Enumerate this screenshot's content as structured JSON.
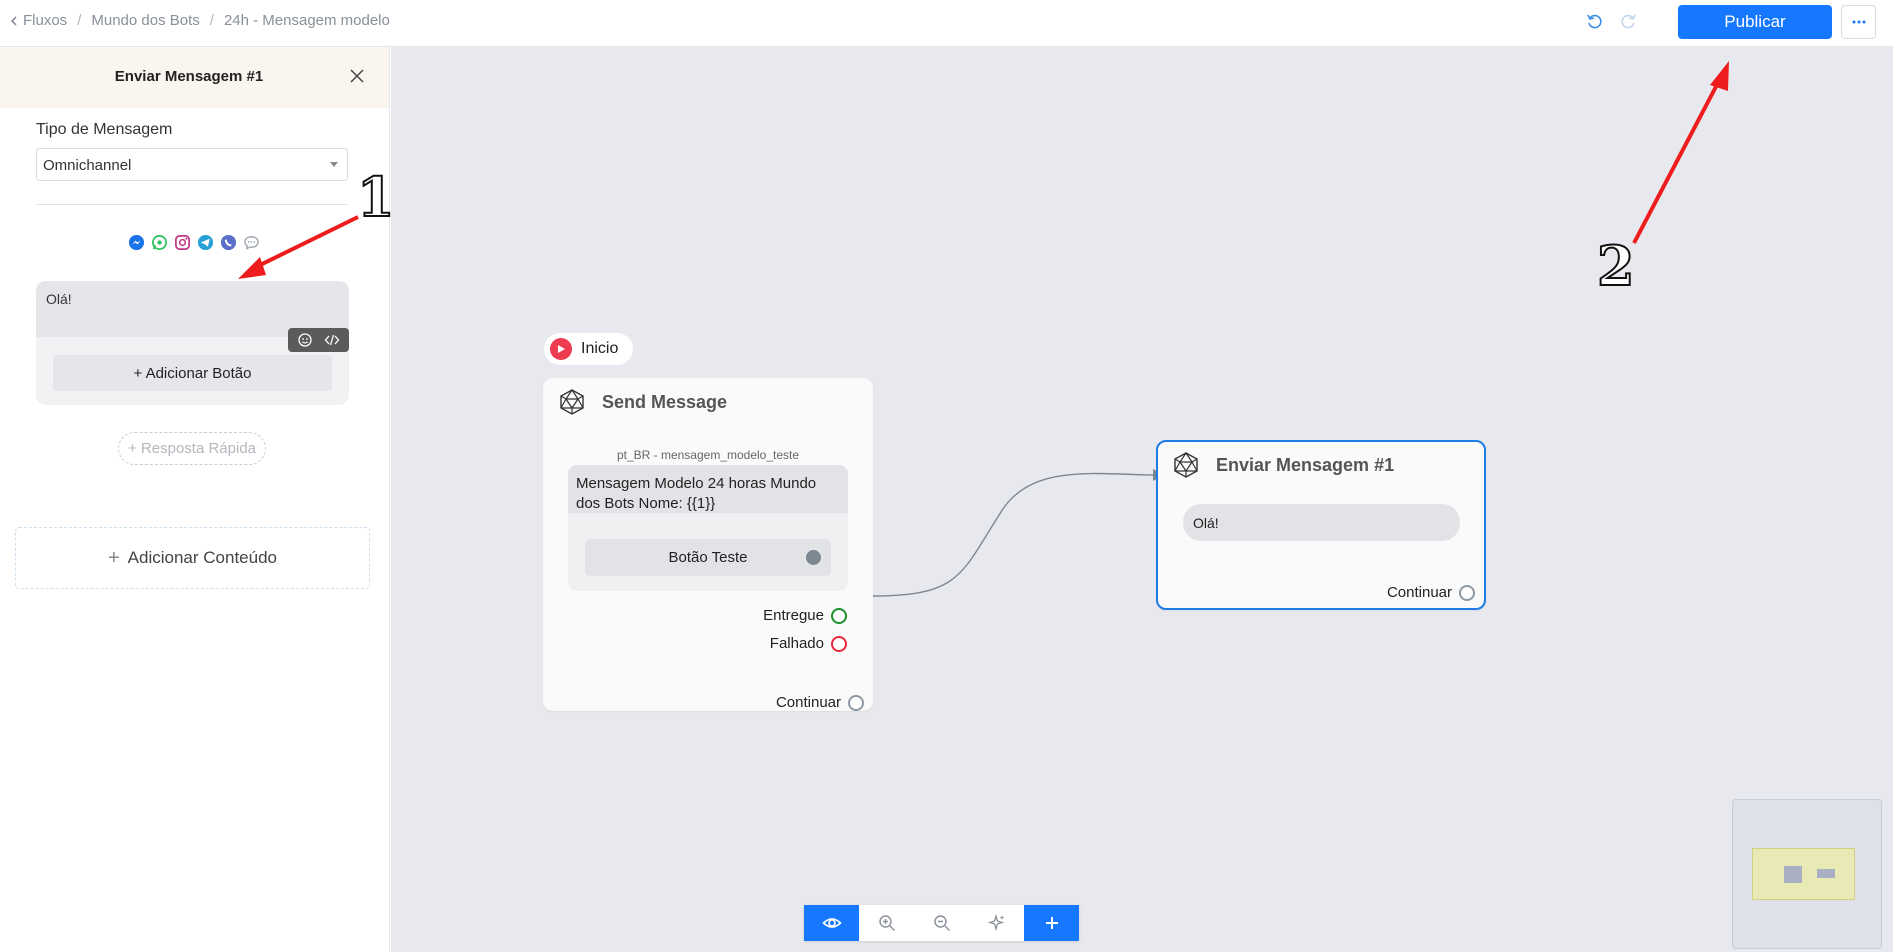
{
  "breadcrumb": {
    "items": [
      "Fluxos",
      "Mundo dos Bots",
      "24h - Mensagem modelo"
    ],
    "separator": "/"
  },
  "topbar": {
    "publish_label": "Publicar",
    "accent_color": "#1677ff"
  },
  "panel": {
    "title": "Enviar Mensagem #1",
    "type_label": "Tipo de Mensagem",
    "type_value": "Omnichannel",
    "channels": [
      "messenger-icon",
      "whatsapp-icon",
      "instagram-icon",
      "telegram-icon",
      "viber-icon",
      "sms-icon"
    ],
    "message_text": "Olá!",
    "add_button_label": "+ Adicionar Botão",
    "quick_reply_label": "+ Resposta Rápida",
    "add_content_label": "Adicionar Conteúdo"
  },
  "annotations": {
    "one": "1",
    "two": "2"
  },
  "canvas": {
    "start_label": "Inicio",
    "send_node": {
      "title": "Send Message",
      "template_name": "pt_BR - mensagem_modelo_teste",
      "template_text": "Mensagem Modelo 24 horas Mundo dos Bots Nome: {{1}}",
      "button_label": "Botão Teste",
      "outputs": {
        "delivered": "Entregue",
        "failed": "Falhado",
        "continue": "Continuar"
      },
      "colors": {
        "delivered": "#1a8f2c",
        "failed": "#e5283a"
      }
    },
    "message_node": {
      "title": "Enviar Mensagem #1",
      "text": "Olá!",
      "continue_label": "Continuar"
    }
  }
}
